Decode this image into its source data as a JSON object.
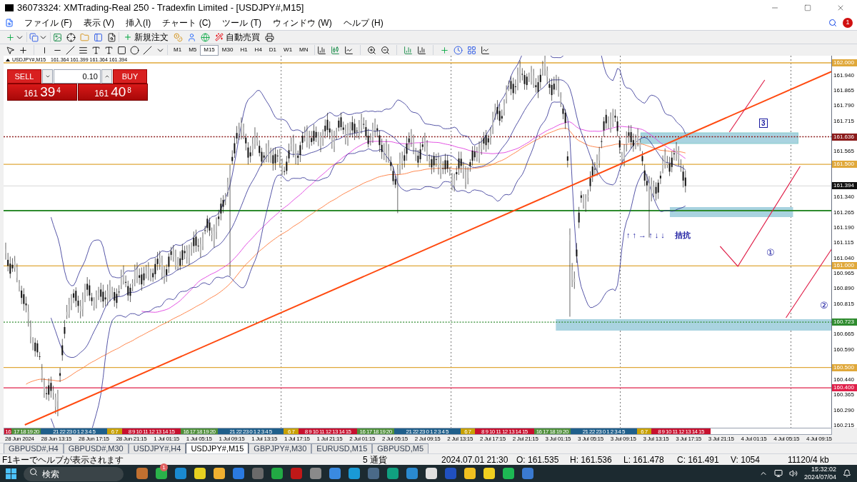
{
  "window": {
    "title": "36073324: XMTrading-Real 250 - Tradexfin Limited - [USDJPY#,M15]"
  },
  "menu": [
    "ファイル (F)",
    "表示 (V)",
    "挿入(I)",
    "チャート (C)",
    "ツール (T)",
    "ウィンドウ (W)",
    "ヘルプ (H)"
  ],
  "notification_badge": "1",
  "toolbar": {
    "new_order": "新規注文",
    "auto_trading": "自動売買"
  },
  "timeframes": [
    {
      "label": "M1",
      "selected": false
    },
    {
      "label": "M5",
      "selected": false
    },
    {
      "label": "M15",
      "selected": true
    },
    {
      "label": "M30",
      "selected": false
    },
    {
      "label": "H1",
      "selected": false
    },
    {
      "label": "H4",
      "selected": false
    },
    {
      "label": "D1",
      "selected": false
    },
    {
      "label": "W1",
      "selected": false
    },
    {
      "label": "MN",
      "selected": false
    }
  ],
  "chart": {
    "header": "USDJPY#,M15",
    "ohlc": "161.364 161.399 161.364 161.394",
    "one_click": {
      "sell": "SELL",
      "buy": "BUY",
      "lot": "0.10",
      "sell_price": {
        "head": "161",
        "big": "39",
        "tail": "4"
      },
      "buy_price": {
        "head": "161",
        "big": "40",
        "tail": "8"
      }
    },
    "annotations": [
      {
        "kind": "boxed",
        "text": "3"
      },
      {
        "kind": "arrows",
        "text": "↑ ↑ → ↑ ↓ ↓"
      },
      {
        "kind": "note",
        "text": "拮抗"
      },
      {
        "kind": "circled",
        "text": "①"
      },
      {
        "kind": "circled",
        "text": "②"
      }
    ],
    "levels": [
      {
        "label": "162.000",
        "color": "#e0a83a"
      },
      {
        "label": "161.636",
        "color": "#8b1a1a"
      },
      {
        "label": "161.500",
        "color": "#e0a83a"
      },
      {
        "label": "161.394",
        "color": "#111111"
      },
      {
        "label": "161.000",
        "color": "#e0a83a"
      },
      {
        "label": "160.723",
        "color": "#2e8b2e"
      },
      {
        "label": "160.500",
        "color": "#e0a83a"
      },
      {
        "label": "160.400",
        "color": "#e0204a"
      }
    ],
    "price_ticks": [
      "161.940",
      "161.865",
      "161.790",
      "161.715",
      "161.565",
      "161.340",
      "161.265",
      "161.190",
      "161.115",
      "161.040",
      "160.965",
      "160.890",
      "160.815",
      "160.665",
      "160.590",
      "160.440",
      "160.365",
      "160.290",
      "160.215"
    ],
    "sessions": [
      {
        "color": "#c8102e",
        "hours": "16"
      },
      {
        "color": "#4f8f3a",
        "hours": "17 18 19 20"
      },
      {
        "color": "#1f5f8b",
        "hours": "21 22 23 0 1 2 3 4 5"
      },
      {
        "color": "#c8a000",
        "hours": "6 7"
      },
      {
        "color": "#c8102e",
        "hours": "8 9 10 11 12 13 14 15"
      },
      {
        "color": "#4f8f3a",
        "hours": "16 17 18 19 20"
      },
      {
        "color": "#1f5f8b",
        "hours": "21 22 23 0 1 2 3 4 5"
      },
      {
        "color": "#c8a000",
        "hours": "6 7"
      },
      {
        "color": "#c8102e",
        "hours": "8 9 10 11 12 13 14 15"
      },
      {
        "color": "#4f8f3a",
        "hours": "16 17 18 19 20"
      },
      {
        "color": "#1f5f8b",
        "hours": "21 22 23 0 1 2 3 4 5"
      },
      {
        "color": "#c8a000",
        "hours": "6 7"
      },
      {
        "color": "#c8102e",
        "hours": "8 9 10 11 12 13 14 15"
      },
      {
        "color": "#4f8f3a",
        "hours": "16 17 18 19 20"
      },
      {
        "color": "#1f5f8b",
        "hours": "21 22 23 0 1 2 3 4 5"
      },
      {
        "color": "#c8a000",
        "hours": "6 7"
      },
      {
        "color": "#c8102e",
        "hours": "8 9 10 11 12 13 14 15"
      }
    ],
    "dates": [
      "28 Jun 2024",
      "28 Jun 13:15",
      "28 Jun 17:15",
      "28 Jun 21:15",
      "1 Jul 01:15",
      "1 Jul 05:15",
      "1 Jul 09:15",
      "1 Jul 13:15",
      "1 Jul 17:15",
      "1 Jul 21:15",
      "2 Jul 01:15",
      "2 Jul 05:15",
      "2 Jul 09:15",
      "2 Jul 13:15",
      "2 Jul 17:15",
      "2 Jul 21:15",
      "3 Jul 01:15",
      "3 Jul 05:15",
      "3 Jul 09:15",
      "3 Jul 13:15",
      "3 Jul 17:15",
      "3 Jul 21:15",
      "4 Jul 01:15",
      "4 Jul 05:15",
      "4 Jul 09:15"
    ]
  },
  "tabs": [
    {
      "label": "GBPUSD#,H4",
      "selected": false
    },
    {
      "label": "GBPUSD#,M30",
      "selected": false
    },
    {
      "label": "USDJPY#,H4",
      "selected": false
    },
    {
      "label": "USDJPY#,M15",
      "selected": true
    },
    {
      "label": "GBPJPY#,M30",
      "selected": false
    },
    {
      "label": "EURUSD,M15",
      "selected": false
    },
    {
      "label": "GBPUSD,M5",
      "selected": false
    }
  ],
  "status_bar": [
    "F1キーでヘルプが表示されます",
    "5 通貨",
    "2024.07.01 21:30",
    "O: 161.535",
    "H: 161.536",
    "L: 161.478",
    "C: 161.491",
    "V: 1054",
    "11120/4 kb"
  ],
  "taskbar": {
    "search": {
      "placeholder": "検索"
    },
    "badge": "1",
    "time": "15:32:02",
    "date": "2024/07/04"
  }
}
